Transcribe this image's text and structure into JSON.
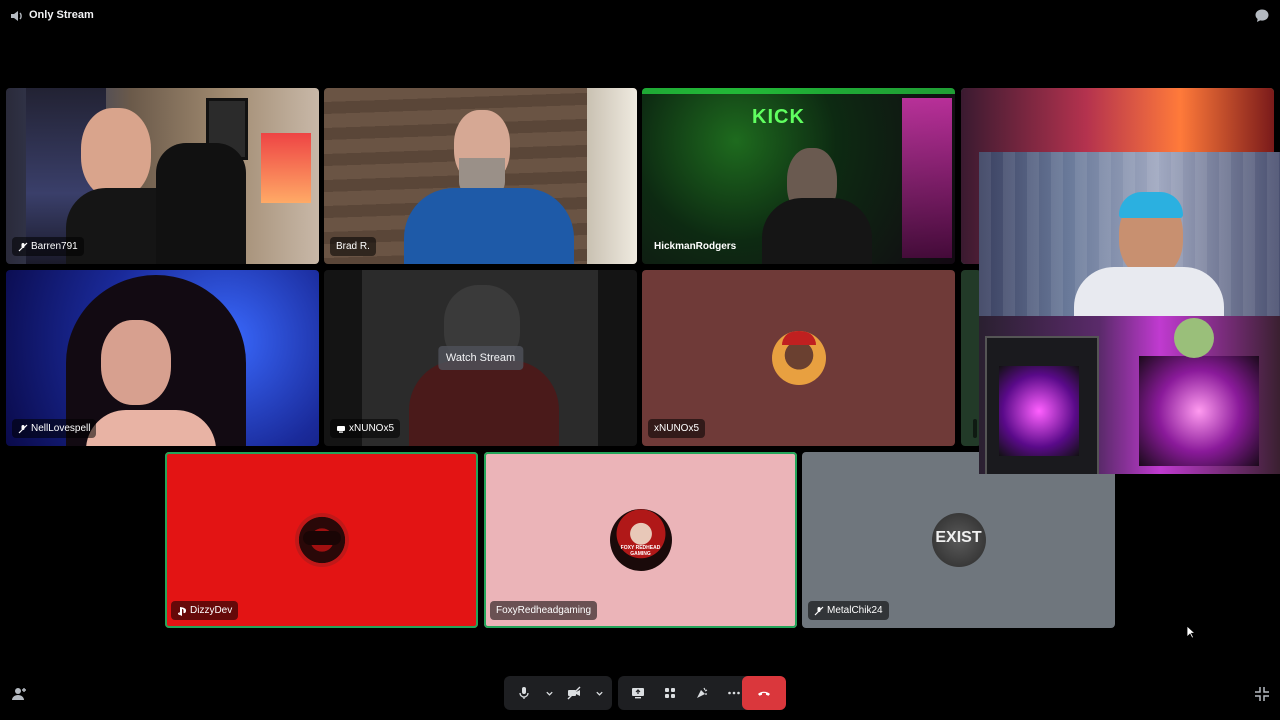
{
  "window": {
    "title": "Only Stream"
  },
  "tiles": [
    {
      "name": "Barren791",
      "status_icon": "mic-muted-icon",
      "speaking": false
    },
    {
      "name": "Brad R.",
      "status_icon": "",
      "speaking": false
    },
    {
      "name": "HickmanRodgers",
      "status_icon": "",
      "speaking": false
    },
    {
      "name": "NellLovespell",
      "status_icon": "mic-muted-icon",
      "speaking": false
    },
    {
      "name": "xNUNOx5",
      "status_icon": "screen-share-icon",
      "speaking": false,
      "button": "Watch Stream"
    },
    {
      "name": "xNUNOx5",
      "status_icon": "",
      "speaking": false
    },
    {
      "name": "DizzyDev",
      "status_icon": "playstation-icon",
      "speaking": true
    },
    {
      "name": "FoxyRedheadgaming",
      "status_icon": "",
      "speaking": true
    },
    {
      "name": "MetalChik24",
      "status_icon": "mic-muted-icon",
      "speaking": false
    },
    {
      "name": "",
      "status_icon": "",
      "speaking": true
    }
  ],
  "avatars": {
    "exist_text": "EXIST",
    "foxy_text": "FOXY REDHEAD GAMING"
  },
  "colors": {
    "speaking": "#23a55a",
    "hangup": "#da373c",
    "dizzy_bg": "#e31414",
    "foxy_bg": "#ebb4b8",
    "metal_bg": "#6f767d",
    "xnuno_bg": "#6f3a38"
  },
  "icons": {
    "top_left": "speaker-icon",
    "top_right": "chat-bubble-icon",
    "bottom_left": "add-person-icon",
    "bottom_right": "exit-fullscreen-icon",
    "controls": [
      "microphone-icon",
      "chevron-down-icon",
      "camera-off-icon",
      "chevron-down-icon",
      "screen-share-icon",
      "activities-icon",
      "soundboard-icon",
      "more-icon",
      "hang-up-icon"
    ]
  }
}
